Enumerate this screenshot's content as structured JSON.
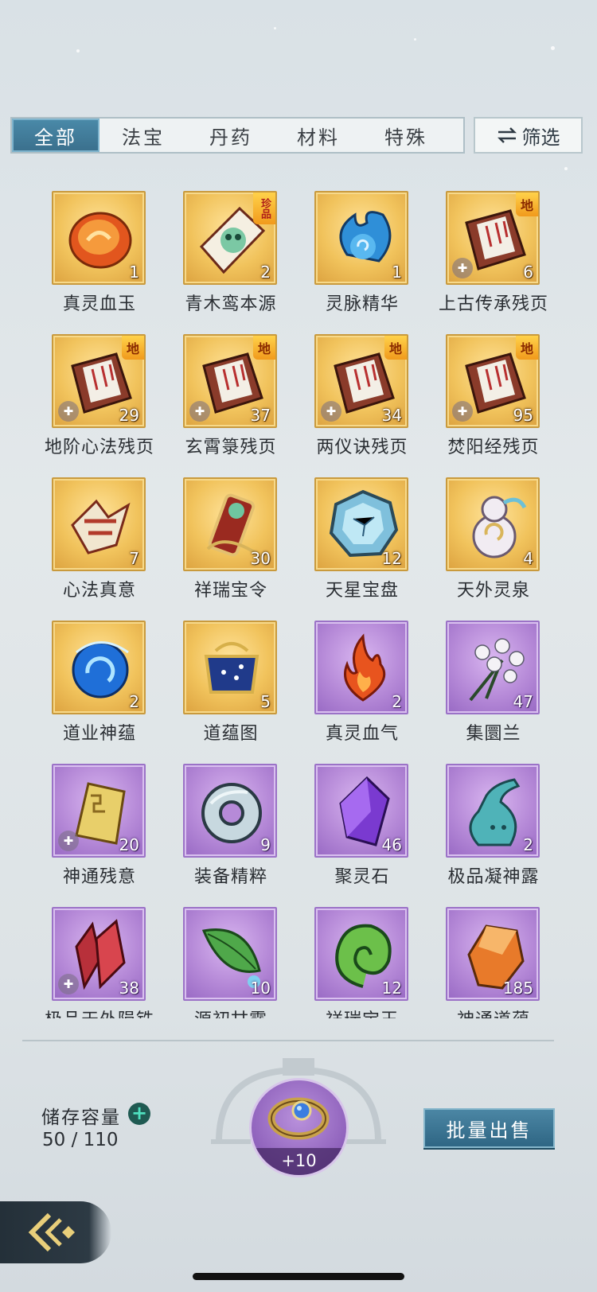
{
  "tabs": [
    {
      "label": "全部",
      "active": true
    },
    {
      "label": "法宝",
      "active": false
    },
    {
      "label": "丹药",
      "active": false
    },
    {
      "label": "材料",
      "active": false
    },
    {
      "label": "特殊",
      "active": false
    }
  ],
  "filter": {
    "label": "筛选",
    "icon": "swap-arrows-icon"
  },
  "items": [
    {
      "name": "真灵血玉",
      "count": "1",
      "rarity": "gold",
      "icon": "blood-jade-icon"
    },
    {
      "name": "青木鸾本源",
      "count": "2",
      "rarity": "gold",
      "icon": "green-phoenix-origin-icon",
      "badge": "珍品"
    },
    {
      "name": "灵脉精华",
      "count": "1",
      "rarity": "gold",
      "icon": "spirit-vein-essence-icon"
    },
    {
      "name": "上古传承残页",
      "count": "6",
      "rarity": "gold",
      "icon": "ancient-scroll-page-icon",
      "badge": "地",
      "fragment": true
    },
    {
      "name": "地阶心法残页",
      "count": "29",
      "rarity": "gold",
      "icon": "scroll-page-icon",
      "badge": "地",
      "fragment": true
    },
    {
      "name": "玄霄箓残页",
      "count": "37",
      "rarity": "gold",
      "icon": "scroll-page-icon",
      "badge": "地",
      "fragment": true
    },
    {
      "name": "两仪诀残页",
      "count": "34",
      "rarity": "gold",
      "icon": "scroll-page-icon",
      "badge": "地",
      "fragment": true
    },
    {
      "name": "焚阳经残页",
      "count": "95",
      "rarity": "gold",
      "icon": "scroll-page-icon",
      "badge": "地",
      "fragment": true
    },
    {
      "name": "心法真意",
      "count": "7",
      "rarity": "gold",
      "icon": "heart-method-icon"
    },
    {
      "name": "祥瑞宝令",
      "count": "30",
      "rarity": "gold",
      "icon": "auspicious-token-icon"
    },
    {
      "name": "天星宝盘",
      "count": "12",
      "rarity": "gold",
      "icon": "star-plate-icon"
    },
    {
      "name": "天外灵泉",
      "count": "4",
      "rarity": "gold",
      "icon": "spirit-spring-gourd-icon"
    },
    {
      "name": "道业神蕴",
      "count": "2",
      "rarity": "gold",
      "icon": "blue-orb-icon"
    },
    {
      "name": "道蕴图",
      "count": "5",
      "rarity": "gold",
      "icon": "dao-map-icon"
    },
    {
      "name": "真灵血气",
      "count": "2",
      "rarity": "purple",
      "icon": "blood-flame-icon"
    },
    {
      "name": "集圜兰",
      "count": "47",
      "rarity": "purple",
      "icon": "orchid-icon"
    },
    {
      "name": "神通残意",
      "count": "20",
      "rarity": "purple",
      "icon": "golden-fragment-icon",
      "fragment": true
    },
    {
      "name": "装备精粹",
      "count": "9",
      "rarity": "purple",
      "icon": "jade-ring-icon"
    },
    {
      "name": "聚灵石",
      "count": "46",
      "rarity": "purple",
      "icon": "purple-crystal-icon"
    },
    {
      "name": "极品凝神露",
      "count": "2",
      "rarity": "purple",
      "icon": "teal-vase-icon"
    },
    {
      "name": "极品天外陨铁",
      "count": "38",
      "rarity": "purple",
      "icon": "red-crystal-icon",
      "fragment": true
    },
    {
      "name": "源初甘露",
      "count": "10",
      "rarity": "purple",
      "icon": "leaf-dew-icon"
    },
    {
      "name": "祥瑞宝玉",
      "count": "12",
      "rarity": "purple",
      "icon": "green-jade-swirl-icon"
    },
    {
      "name": "神通道蕴",
      "count": "185",
      "rarity": "purple",
      "icon": "amber-crystal-icon"
    }
  ],
  "storage": {
    "label": "储存容量",
    "value": "50 / 110"
  },
  "equip_ring": {
    "label": "+10",
    "icon": "ring-icon"
  },
  "sell_button": {
    "label": "批量出售"
  },
  "back_button": {
    "icon": "back-arrow-icon"
  },
  "colors": {
    "gold_slot": "#f1c35c",
    "purple_slot": "#b68ad8",
    "tab_active": "#4a8aa9",
    "sell_button": "#3a7595"
  }
}
